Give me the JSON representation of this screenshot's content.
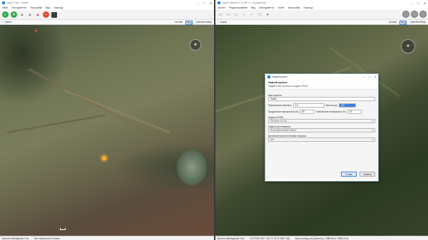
{
  "left": {
    "title": "UgCS Pilot - Flame",
    "menu": [
      "Файл",
      "Инструменты",
      "Настройки",
      "Вид",
      "Помощь"
    ],
    "tab_label": "Карта",
    "map_providers": [
      "Landsat",
      "Bing",
      "OpenStreetMap"
    ],
    "active_provider": "Bing",
    "status": [
      "Высота наблюдения 2 км",
      "Вне поверхности Земли"
    ],
    "marker_letter": "A"
  },
  "right": {
    "title": "UgCS Mission 2.13 (R.?) - 6 результат",
    "menu": [
      "Проект",
      "Редактирование",
      "Вид",
      "Инструменты",
      "Полет",
      "Настройки",
      "Помощь"
    ],
    "tab_label": "Карта",
    "map_providers": [
      "Landsat",
      "Bing",
      "OpenStreetMap"
    ],
    "active_provider": "Bing",
    "status": [
      "Высота наблюдения 9 км",
      "34°22'28.0190\" СШ 74°22'21.5861\" ВД",
      "Высота (над у.м.(эллипсо.)): 1886.65 м / 1882.04 м"
    ]
  },
  "dialog": {
    "title": "Новый проект",
    "heading": "Новый проект",
    "subtitle": "Задайте имя проекта и модель БПЛА",
    "project_name_label": "Имя проекта",
    "project_name_value": "Tester",
    "resolution_label": "Разрешение (см/пикс)",
    "resolution_value": "2.2",
    "height_label": "Высота (м)",
    "height_value": "100",
    "front_overlap_label": "Продольное перекрытие (%)",
    "front_overlap_value": "80",
    "side_overlap_label": "Поперечное перекрытие (%)",
    "side_overlap_value": "70",
    "uav_label": "Модель БПЛА",
    "uav_value": "Geoscan 101-AI",
    "camera_label": "Модель фотокамеры",
    "camera_value": "Sony Alpha A5000 20mm",
    "payload_label": "Дополнительная полезная нагрузка",
    "payload_value": "нет",
    "ok_label": "Готово",
    "cancel_label": "Отмена"
  },
  "colors": {
    "accent": "#3c7ede",
    "play": "#2fa84f",
    "record": "#e04b3a"
  }
}
